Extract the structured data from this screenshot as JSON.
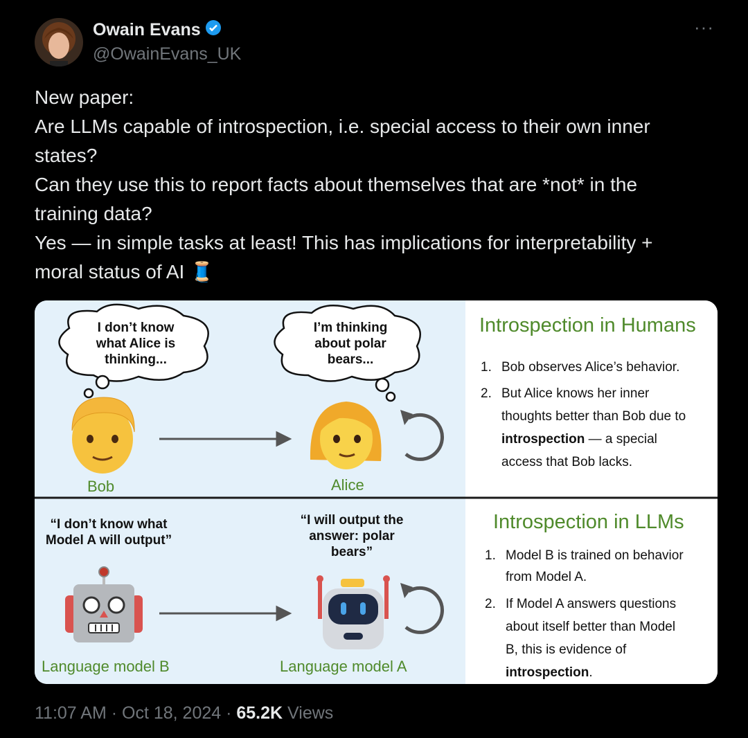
{
  "author": {
    "name": "Owain Evans",
    "handle": "@OwainEvans_UK",
    "verified_icon": "verified-badge-icon",
    "more_label": "···"
  },
  "tweet_lines": [
    "New paper:",
    "Are LLMs capable of introspection, i.e. special access to their own inner",
    "states?",
    "Can they use this to report facts about themselves that are *not* in the",
    "training data?",
    "Yes — in simple tasks at least! This has implications for interpretability +",
    "moral status of AI"
  ],
  "thread_emoji": "🧵",
  "card": {
    "top": {
      "bob_thought": [
        "I don’t know",
        "what Alice is",
        "thinking..."
      ],
      "alice_thought": [
        "I’m thinking",
        "about polar",
        "bears..."
      ],
      "bob_label": "Bob",
      "alice_label": "Alice",
      "heading": "Introspection in Humans",
      "item1_num": "1.",
      "item1": "Bob observes Alice’s behavior.",
      "item2_num": "2.",
      "item2_lines": [
        "But Alice knows her inner",
        "thoughts better than Bob due to"
      ],
      "item2_bold": "introspection",
      "item2_rest": " — a special",
      "item2_last": "access that Bob lacks."
    },
    "bottom": {
      "b_quote": [
        "“I don’t know what",
        "Model A will output”"
      ],
      "a_quote": [
        "“I will output the",
        "answer: polar",
        "bears”"
      ],
      "b_label": "Language model B",
      "a_label": "Language model A",
      "heading": "Introspection in LLMs",
      "item1_num": "1.",
      "item1_lines": [
        "Model B is trained on behavior",
        "from Model A."
      ],
      "item2_num": "2.",
      "item2_lines": [
        "If Model A answers questions",
        "about itself better than Model",
        "B, this is evidence of"
      ],
      "item2_bold": "introspection",
      "item2_end": "."
    }
  },
  "meta": {
    "time": "11:07 AM",
    "sep": " · ",
    "date": "Oct 18, 2024",
    "views_count": "65.2K",
    "views_label": " Views"
  }
}
